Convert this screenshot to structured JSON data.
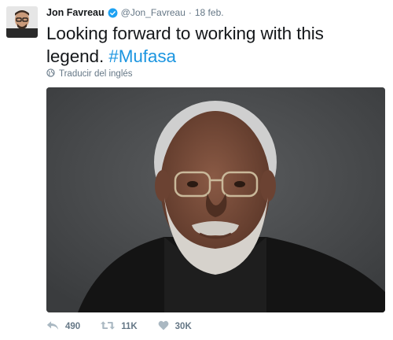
{
  "tweet": {
    "author_name": "Jon Favreau",
    "handle": "@Jon_Favreau",
    "separator": "·",
    "date": "18 feb.",
    "text_main": "Looking forward to working with this legend. ",
    "hashtag": "#Mufasa",
    "translate_label": "Traducir del inglés",
    "icons": {
      "verified": "verified-badge-icon",
      "translate": "globe-icon",
      "reply": "reply-icon",
      "retweet": "retweet-icon",
      "like": "heart-icon"
    },
    "colors": {
      "link": "#1b95e0",
      "meta": "#657786",
      "text": "#14171a"
    }
  },
  "actions": {
    "reply_count": "490",
    "retweet_count": "11K",
    "like_count": "30K"
  }
}
